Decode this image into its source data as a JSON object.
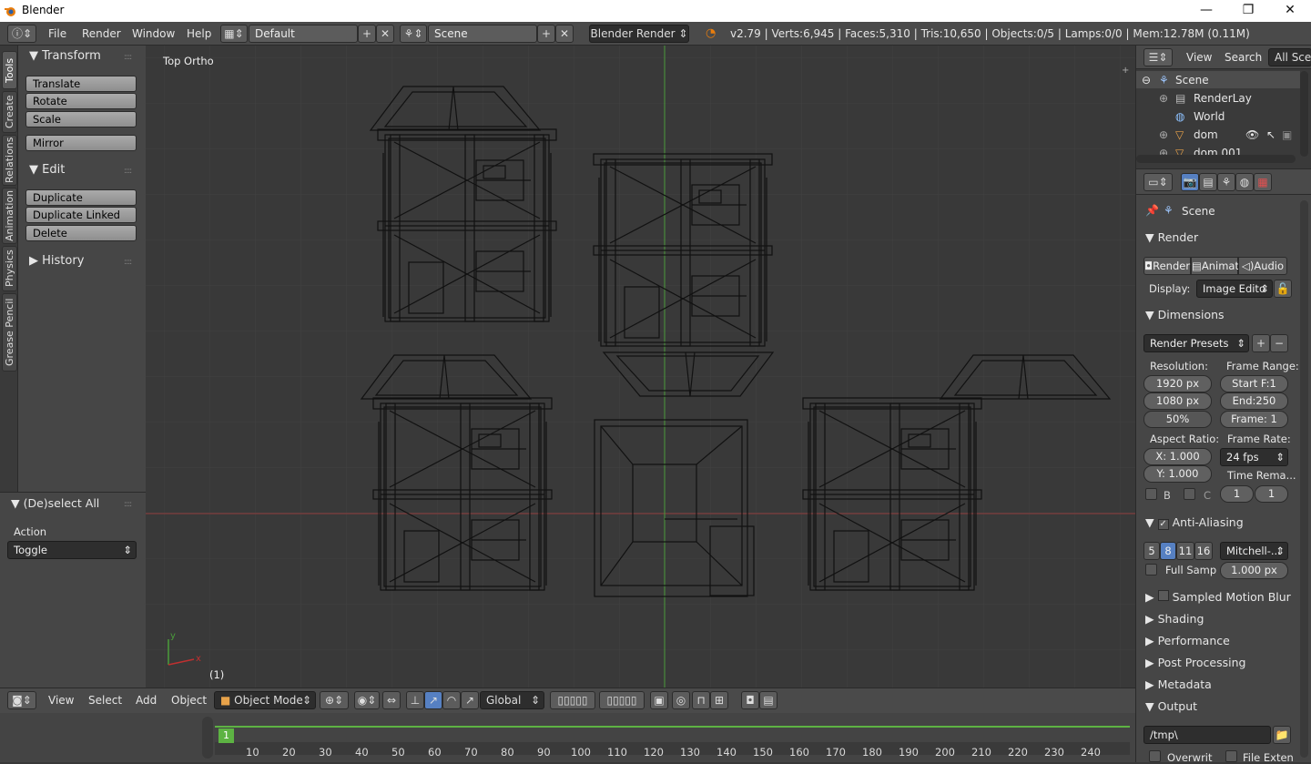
{
  "window": {
    "title": "Blender",
    "minimize": "—",
    "restore": "❐",
    "close": "✕"
  },
  "info_header": {
    "menus": [
      "File",
      "Render",
      "Window",
      "Help"
    ],
    "layout": "Default",
    "scene": "Scene",
    "engine": "Blender Render",
    "stats": "v2.79 | Verts:6,945 | Faces:5,310 | Tris:10,650 | Objects:0/5 | Lamps:0/0 | Mem:12.78M (0.11M)"
  },
  "side_tabs": [
    "Tools",
    "Create",
    "Relations",
    "Animation",
    "Physics",
    "Grease Pencil"
  ],
  "tool_shelf": {
    "transform_title": "Transform",
    "transform_buttons": [
      "Translate",
      "Rotate",
      "Scale"
    ],
    "mirror": "Mirror",
    "edit_title": "Edit",
    "edit_buttons": [
      "Duplicate",
      "Duplicate Linked",
      "Delete"
    ],
    "history_title": "History"
  },
  "operator_panel": {
    "title": "(De)select All",
    "action_label": "Action",
    "action_value": "Toggle"
  },
  "viewport": {
    "view_name": "Top Ortho",
    "frame_indicator": "(1)",
    "axis_x": "x",
    "axis_y": "y"
  },
  "viewport_header": {
    "menus": [
      "View",
      "Select",
      "Add",
      "Object"
    ],
    "mode": "Object Mode",
    "orientation": "Global"
  },
  "timeline": {
    "current_frame": "1",
    "ticks": [
      "10",
      "20",
      "30",
      "40",
      "50",
      "60",
      "70",
      "80",
      "90",
      "100",
      "110",
      "120",
      "130",
      "140",
      "150",
      "160",
      "170",
      "180",
      "190",
      "200",
      "210",
      "220",
      "230",
      "240"
    ]
  },
  "outliner": {
    "menus": [
      "View",
      "Search"
    ],
    "filter": "All Scen",
    "items": [
      "Scene",
      "RenderLay",
      "World",
      "dom",
      "dom.001"
    ]
  },
  "properties": {
    "context": "Scene",
    "render_title": "Render",
    "render_buttons": [
      "Render",
      "Animat",
      "Audio"
    ],
    "display_label": "Display:",
    "display_value": "Image Edito",
    "dimensions_title": "Dimensions",
    "presets": "Render Presets",
    "resolution_label": "Resolution:",
    "res_x": "1920 px",
    "res_y": "1080 px",
    "res_pct": "50%",
    "frame_range_label": "Frame Range:",
    "start": "Start F:1",
    "end": "End:250",
    "frame": "Frame: 1",
    "aspect_label": "Aspect Ratio:",
    "aspect_x": "X: 1.000",
    "aspect_y": "Y: 1.000",
    "frame_rate_label": "Frame Rate:",
    "fps": "24 fps",
    "time_remap_label": "Time Rema...",
    "remap_old": "1",
    "remap_new": "1",
    "border_b": "B",
    "crop_c": "C",
    "aa_title": "Anti-Aliasing",
    "aa_samples": [
      "5",
      "8",
      "11",
      "16"
    ],
    "aa_filter": "Mitchell-...",
    "full_sample": "Full Samp",
    "filter_size": "1.000 px",
    "motion_blur": "Sampled Motion Blur",
    "shading": "Shading",
    "performance": "Performance",
    "post_processing": "Post Processing",
    "metadata": "Metadata",
    "output_title": "Output",
    "output_path": "/tmp\\",
    "overwrite": "Overwrit",
    "file_ext": "File Exten"
  },
  "colors": {
    "selected_blue": "#5680c2",
    "frame_green": "#5db343",
    "x_axis": "#8f3a3a",
    "y_axis": "#4a9c3a"
  }
}
